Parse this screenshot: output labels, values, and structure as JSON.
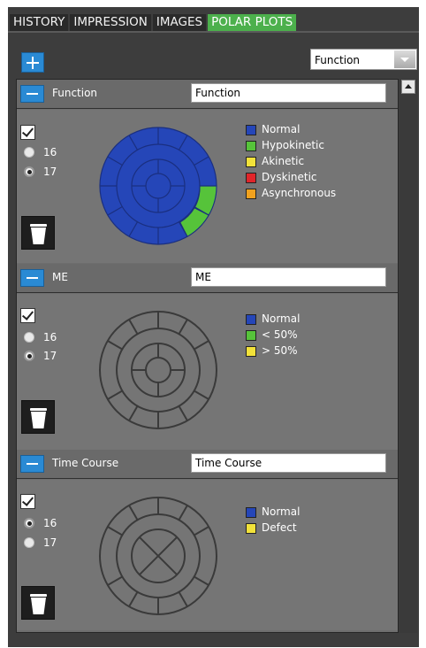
{
  "tabs": [
    {
      "label": "HISTORY",
      "active": false
    },
    {
      "label": "IMPRESSION",
      "active": false
    },
    {
      "label": "IMAGES",
      "active": false
    },
    {
      "label": "POLAR PLOTS",
      "active": true
    }
  ],
  "toolbar": {
    "add_icon": "plus-icon",
    "plot_type_select": {
      "value": "Function"
    }
  },
  "panels": [
    {
      "title": "Function",
      "name_value": "Function",
      "checked": true,
      "segments": [
        {
          "label": "16",
          "selected": false
        },
        {
          "label": "17",
          "selected": true
        }
      ],
      "legend": [
        {
          "label": "Normal",
          "color": "#2546b8"
        },
        {
          "label": "Hypokinetic",
          "color": "#56c33a"
        },
        {
          "label": "Akinetic",
          "color": "#f2e23a"
        },
        {
          "label": "Dyskinetic",
          "color": "#e0252a"
        },
        {
          "label": "Asynchronous",
          "color": "#f0a11e"
        }
      ],
      "plot_fill": "#2546b8",
      "highlight_color": "#56c33a"
    },
    {
      "title": "ME",
      "name_value": "ME",
      "checked": true,
      "segments": [
        {
          "label": "16",
          "selected": false
        },
        {
          "label": "17",
          "selected": true
        }
      ],
      "legend": [
        {
          "label": "Normal",
          "color": "#2546b8"
        },
        {
          "label": "< 50%",
          "color": "#56c33a"
        },
        {
          "label": "> 50%",
          "color": "#f2e23a"
        }
      ]
    },
    {
      "title": "Time Course",
      "name_value": "Time Course",
      "checked": true,
      "segments": [
        {
          "label": "16",
          "selected": true
        },
        {
          "label": "17",
          "selected": false
        }
      ],
      "legend": [
        {
          "label": "Normal",
          "color": "#2546b8"
        },
        {
          "label": "Defect",
          "color": "#f2e23a"
        }
      ]
    }
  ]
}
